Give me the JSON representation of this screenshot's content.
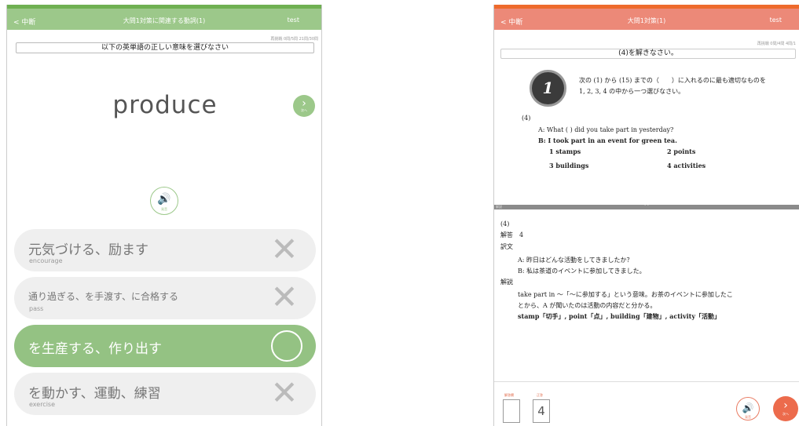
{
  "left": {
    "nav": {
      "back": "< 中断",
      "title": "大問1対策に関連する動詞(1)",
      "user": "test"
    },
    "stats": "再挑戦 0問/5問  21問/30問",
    "instruction": "以下の英単語の正しい意味を選びなさい",
    "word": "produce",
    "next_label": "次へ",
    "sound_label": "発音",
    "choices": [
      {
        "main": "元気づける、励ます",
        "sub": "encourage",
        "mark": "✕",
        "correct": false
      },
      {
        "main": "通り過ぎる、を手渡す、に合格する",
        "sub": "pass",
        "mark": "✕",
        "correct": false
      },
      {
        "main": "を生産する、作り出す",
        "sub": "",
        "mark": "",
        "correct": true
      },
      {
        "main": "を動かす、運動、練習",
        "sub": "exercise",
        "mark": "✕",
        "correct": false
      }
    ]
  },
  "right": {
    "nav": {
      "back": "< 中断",
      "title": "大問1対策(1)",
      "user": "test"
    },
    "stats": "再挑戦 0問/4問  4問/1",
    "instruction": "(4)を解きなさい。",
    "question_number": "1",
    "question_text_1": "次の (1) から (15) までの（　　）に入れるのに最も適切なものを",
    "question_text_2": "1, 2, 3, 4 の中から一つ選びなさい。",
    "q_label": "(4)",
    "line_a": "A:  What (      ) did you take part in yesterday?",
    "line_b": "B:  I took part in an event for green tea.",
    "options": [
      "1   stamps",
      "2   points",
      "3   buildings",
      "4   activities"
    ],
    "divider_tag": "解説",
    "ans_label": "(4)",
    "kaitou": "解答　4",
    "yakubun": "訳文",
    "trans_a": "A:  昨日はどんな活動をしてきましたか？",
    "trans_b": "B:  私は茶道のイベントに参加してきました。",
    "kaisetsu": "解説",
    "expl_1": "take part in ～「～に参加する」という意味。お茶のイベントに参加したこ",
    "expl_2": "とから、A が聞いたのは活動の内容だと分かる。",
    "expl_3": "stamp「切手」, point「点」, building「建物」, activity「活動」",
    "answer_area_label": "解答欄",
    "correct_label": "正答",
    "correct_answer": "4",
    "sound_label": "発音",
    "next_label": "次へ"
  },
  "colors": {
    "left_accent": "#6fb052",
    "left_nav": "#9cc88a",
    "right_accent": "#ee6a2c",
    "right_nav": "#ec8978"
  }
}
